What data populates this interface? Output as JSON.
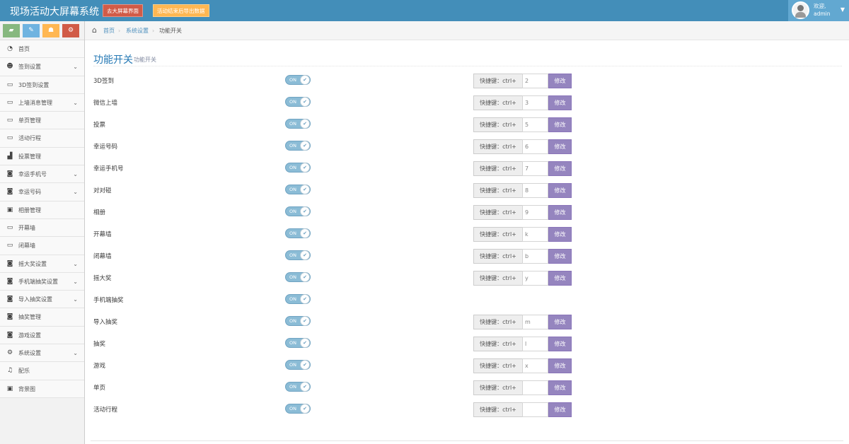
{
  "header": {
    "brand": "现场活动大屏幕系统",
    "big_screen_button": "去大屏幕界面",
    "clear_data_button": "活动结束后导出数据",
    "welcome": "欢迎,",
    "username": "admin"
  },
  "shortcuts": [
    {
      "icon": "comment-icon",
      "glyph": "▰"
    },
    {
      "icon": "pencil-icon",
      "glyph": "✎"
    },
    {
      "icon": "users-icon",
      "glyph": "☗"
    },
    {
      "icon": "cogs-icon",
      "glyph": "⚙"
    }
  ],
  "sidebar": {
    "items": [
      {
        "label": "首页",
        "icon": "dashboard-icon",
        "glyph": "◔",
        "submenu": false
      },
      {
        "label": "签到设置",
        "icon": "users-icon",
        "glyph": "☻",
        "submenu": true
      },
      {
        "label": "3D签到设置",
        "icon": "desktop-icon",
        "glyph": "▭",
        "submenu": false
      },
      {
        "label": "上墙消息管理",
        "icon": "desktop-icon",
        "glyph": "▭",
        "submenu": true
      },
      {
        "label": "单页管理",
        "icon": "desktop-icon",
        "glyph": "▭",
        "submenu": false
      },
      {
        "label": "活动行程",
        "icon": "desktop-icon",
        "glyph": "▭",
        "submenu": false
      },
      {
        "label": "投票管理",
        "icon": "signal-icon",
        "glyph": "▟",
        "submenu": false
      },
      {
        "label": "幸运手机号",
        "icon": "gift-icon",
        "glyph": "◙",
        "submenu": true
      },
      {
        "label": "幸运号码",
        "icon": "gift-icon",
        "glyph": "◙",
        "submenu": true
      },
      {
        "label": "相册管理",
        "icon": "picture-icon",
        "glyph": "▣",
        "submenu": false
      },
      {
        "label": "开幕墙",
        "icon": "desktop-icon",
        "glyph": "▭",
        "submenu": false
      },
      {
        "label": "闭幕墙",
        "icon": "desktop-icon",
        "glyph": "▭",
        "submenu": false
      },
      {
        "label": "摇大奖设置",
        "icon": "gift-icon",
        "glyph": "◙",
        "submenu": true
      },
      {
        "label": "手机端抽奖设置",
        "icon": "gift-icon",
        "glyph": "◙",
        "submenu": true
      },
      {
        "label": "导入抽奖设置",
        "icon": "gift-icon",
        "glyph": "◙",
        "submenu": true
      },
      {
        "label": "抽奖管理",
        "icon": "gift-icon",
        "glyph": "◙",
        "submenu": false
      },
      {
        "label": "游戏设置",
        "icon": "gift-icon",
        "glyph": "◙",
        "submenu": false
      },
      {
        "label": "系统设置",
        "icon": "cog-icon",
        "glyph": "⚙",
        "submenu": true
      },
      {
        "label": "配乐",
        "icon": "music-icon",
        "glyph": "♫",
        "submenu": false
      },
      {
        "label": "背景图",
        "icon": "picture-icon",
        "glyph": "▣",
        "submenu": false
      }
    ]
  },
  "breadcrumb": {
    "home": "首页",
    "sep": "›",
    "system": "系统设置",
    "current": "功能开关"
  },
  "page": {
    "title": "功能开关",
    "subtitle": "功能开关"
  },
  "labels": {
    "toggle_on": "ON",
    "check": "✔",
    "hotkey_prefix": "快捷键：ctrl+",
    "modify_button": "修改"
  },
  "features": [
    {
      "name": "3D签到",
      "enabled": true,
      "hotkey": "2"
    },
    {
      "name": "微信上墙",
      "enabled": true,
      "hotkey": "3"
    },
    {
      "name": "投票",
      "enabled": true,
      "hotkey": "5"
    },
    {
      "name": "幸运号码",
      "enabled": true,
      "hotkey": "6"
    },
    {
      "name": "幸运手机号",
      "enabled": true,
      "hotkey": "7"
    },
    {
      "name": "对对碰",
      "enabled": true,
      "hotkey": "8"
    },
    {
      "name": "相册",
      "enabled": true,
      "hotkey": "9"
    },
    {
      "name": "开幕墙",
      "enabled": true,
      "hotkey": "k"
    },
    {
      "name": "闭幕墙",
      "enabled": true,
      "hotkey": "b"
    },
    {
      "name": "摇大奖",
      "enabled": true,
      "hotkey": "y"
    },
    {
      "name": "手机端抽奖",
      "enabled": true,
      "hotkey": null
    },
    {
      "name": "导入抽奖",
      "enabled": true,
      "hotkey": "m"
    },
    {
      "name": "抽奖",
      "enabled": true,
      "hotkey": "l"
    },
    {
      "name": "游戏",
      "enabled": true,
      "hotkey": "x"
    },
    {
      "name": "单页",
      "enabled": true,
      "hotkey": ""
    },
    {
      "name": "活动行程",
      "enabled": true,
      "hotkey": ""
    }
  ]
}
